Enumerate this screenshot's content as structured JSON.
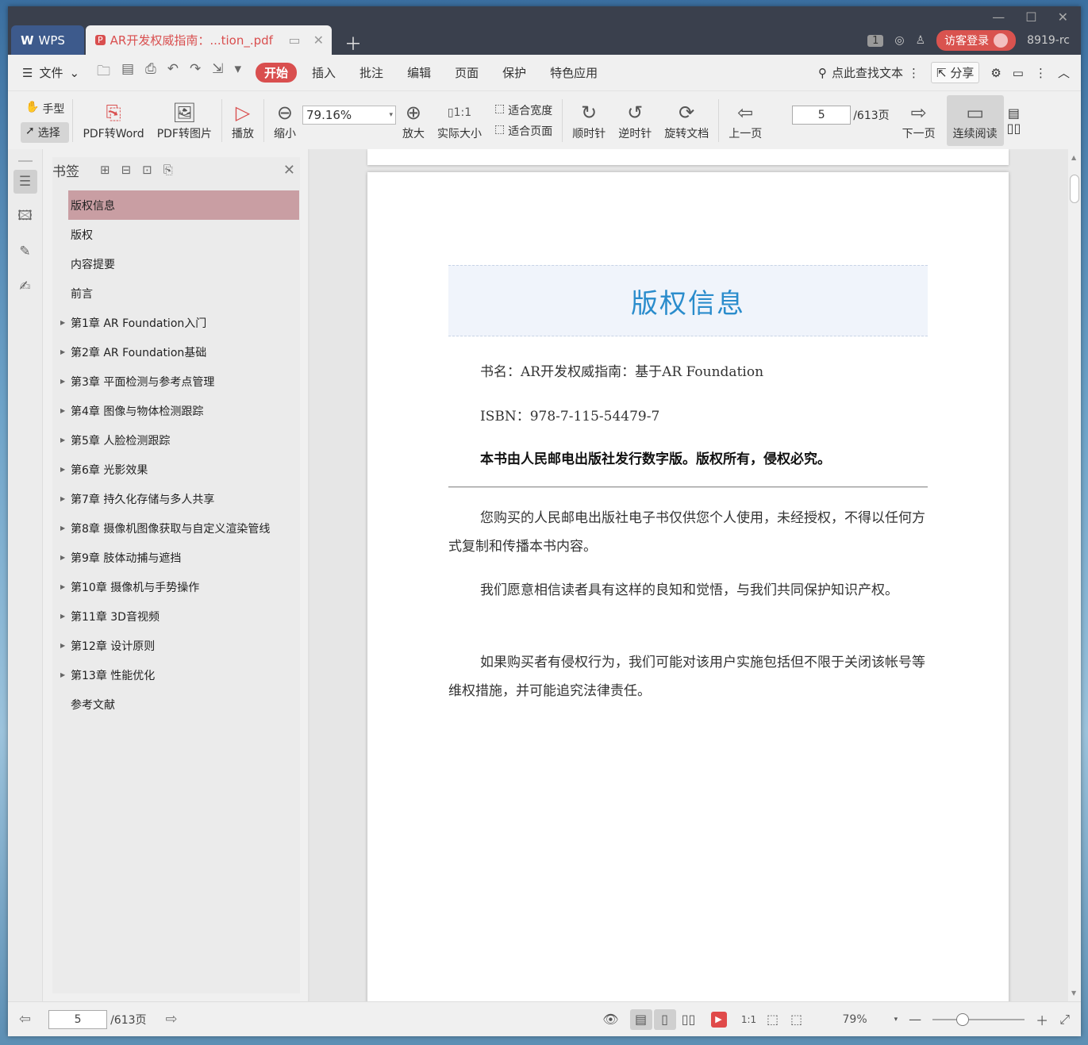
{
  "titlebar": {
    "wps_tab": "WPS",
    "doc_tab": "AR开发权威指南：...tion_.pdf",
    "badge": "1",
    "login": "访客登录",
    "user": "8919-rc"
  },
  "menubar": {
    "file": "文件",
    "tabs": [
      "开始",
      "插入",
      "批注",
      "编辑",
      "页面",
      "保护",
      "特色应用"
    ],
    "search": "点此查找文本",
    "share": "分享"
  },
  "ribbon": {
    "hand": "手型",
    "select": "选择",
    "pdf2word": "PDF转Word",
    "pdf2img": "PDF转图片",
    "play": "播放",
    "zoom_out": "缩小",
    "zoom_value": "79.16%",
    "zoom_in": "放大",
    "actual_size": "实际大小",
    "fit_width": "适合宽度",
    "fit_page": "适合页面",
    "clockwise": "顺时针",
    "counter_clockwise": "逆时针",
    "rotate_doc": "旋转文档",
    "prev_page": "上一页",
    "page_value": "5",
    "page_total": "/613页",
    "next_page": "下一页",
    "continuous": "连续阅读"
  },
  "bookmarks": {
    "title": "书签",
    "items": [
      {
        "label": "版权信息",
        "expandable": false
      },
      {
        "label": "版权",
        "expandable": false
      },
      {
        "label": "内容提要",
        "expandable": false
      },
      {
        "label": "前言",
        "expandable": false
      },
      {
        "label": "第1章 AR Foundation入门",
        "expandable": true
      },
      {
        "label": "第2章 AR Foundation基础",
        "expandable": true
      },
      {
        "label": "第3章 平面检测与参考点管理",
        "expandable": true
      },
      {
        "label": "第4章 图像与物体检测跟踪",
        "expandable": true
      },
      {
        "label": "第5章 人脸检测跟踪",
        "expandable": true
      },
      {
        "label": "第6章 光影效果",
        "expandable": true
      },
      {
        "label": "第7章 持久化存储与多人共享",
        "expandable": true
      },
      {
        "label": "第8章 摄像机图像获取与自定义渲染管线",
        "expandable": true
      },
      {
        "label": "第9章 肢体动捕与遮挡",
        "expandable": true
      },
      {
        "label": "第10章 摄像机与手势操作",
        "expandable": true
      },
      {
        "label": "第11章 3D音视频",
        "expandable": true
      },
      {
        "label": "第12章 设计原则",
        "expandable": true
      },
      {
        "label": "第13章 性能优化",
        "expandable": true
      },
      {
        "label": "参考文献",
        "expandable": false
      }
    ]
  },
  "document": {
    "heading": "版权信息",
    "book_name": "书名：AR开发权威指南：基于AR Foundation",
    "isbn": "ISBN：978-7-115-54479-7",
    "notice": "本书由人民邮电出版社发行数字版。版权所有，侵权必究。",
    "paragraphs": [
      "您购买的人民邮电出版社电子书仅供您个人使用，未经授权，不得以任何方式复制和传播本书内容。",
      "我们愿意相信读者具有这样的良知和觉悟，与我们共同保护知识产权。",
      "如果购买者有侵权行为，我们可能对该用户实施包括但不限于关闭该帐号等维权措施，并可能追究法律责任。"
    ]
  },
  "statusbar": {
    "page_value": "5",
    "page_total": "/613页",
    "zoom": "79%",
    "zoom_slider_fraction": 0.33
  },
  "colors": {
    "accent": "#d94f4f",
    "heading_blue": "#2a8ccc",
    "bookmark_selected": "#c99ea3"
  }
}
